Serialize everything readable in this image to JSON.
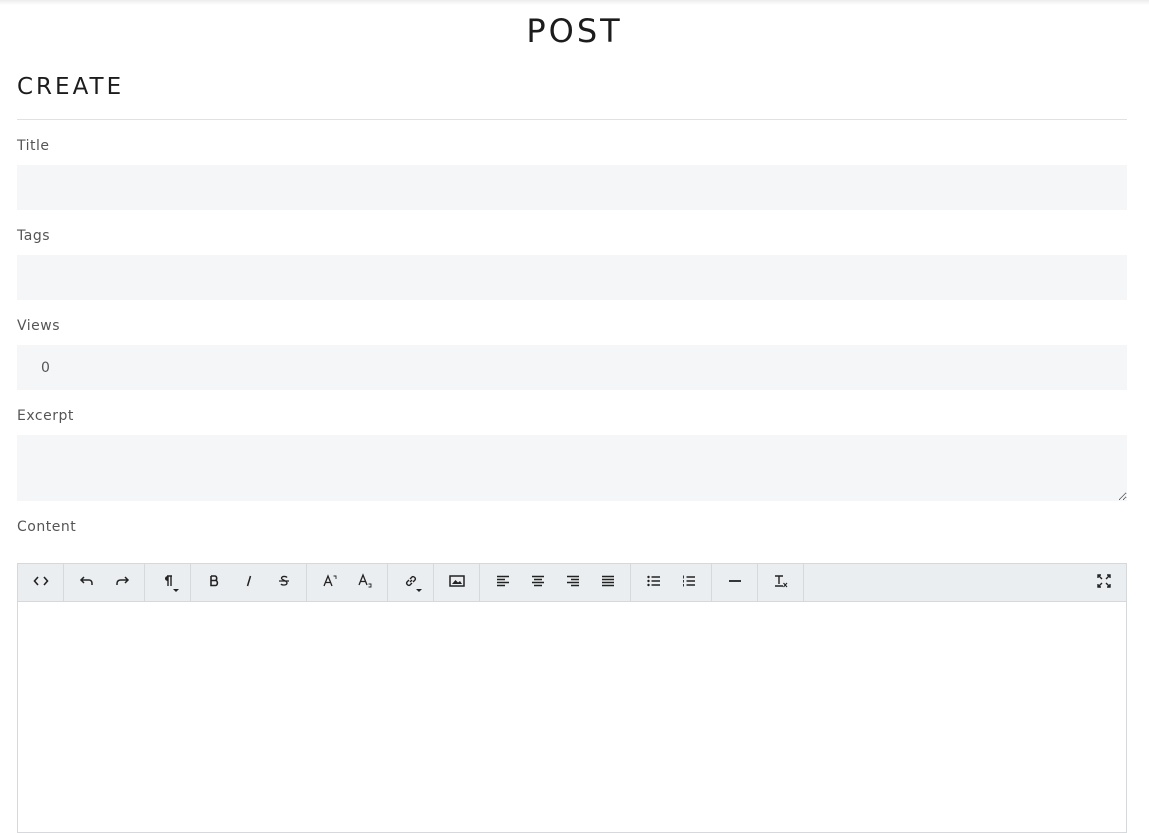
{
  "page": {
    "title": "POST"
  },
  "section": {
    "title": "CREATE"
  },
  "form": {
    "title_label": "Title",
    "title_value": "",
    "tags_label": "Tags",
    "tags_value": "",
    "views_label": "Views",
    "views_value": "0",
    "excerpt_label": "Excerpt",
    "excerpt_value": "",
    "content_label": "Content"
  },
  "toolbar": {
    "groups": [
      [
        "code-view-icon"
      ],
      [
        "undo-icon",
        "redo-icon"
      ],
      [
        "paragraph-format-icon"
      ],
      [
        "bold-icon",
        "italic-icon",
        "strikethrough-icon"
      ],
      [
        "superscript-icon",
        "subscript-icon"
      ],
      [
        "link-icon"
      ],
      [
        "image-icon"
      ],
      [
        "align-left-icon",
        "align-center-icon",
        "align-right-icon",
        "align-justify-icon"
      ],
      [
        "bulleted-list-icon",
        "numbered-list-icon"
      ],
      [
        "horizontal-rule-icon"
      ],
      [
        "clear-formatting-icon"
      ]
    ],
    "right": [
      "fullscreen-icon"
    ]
  }
}
